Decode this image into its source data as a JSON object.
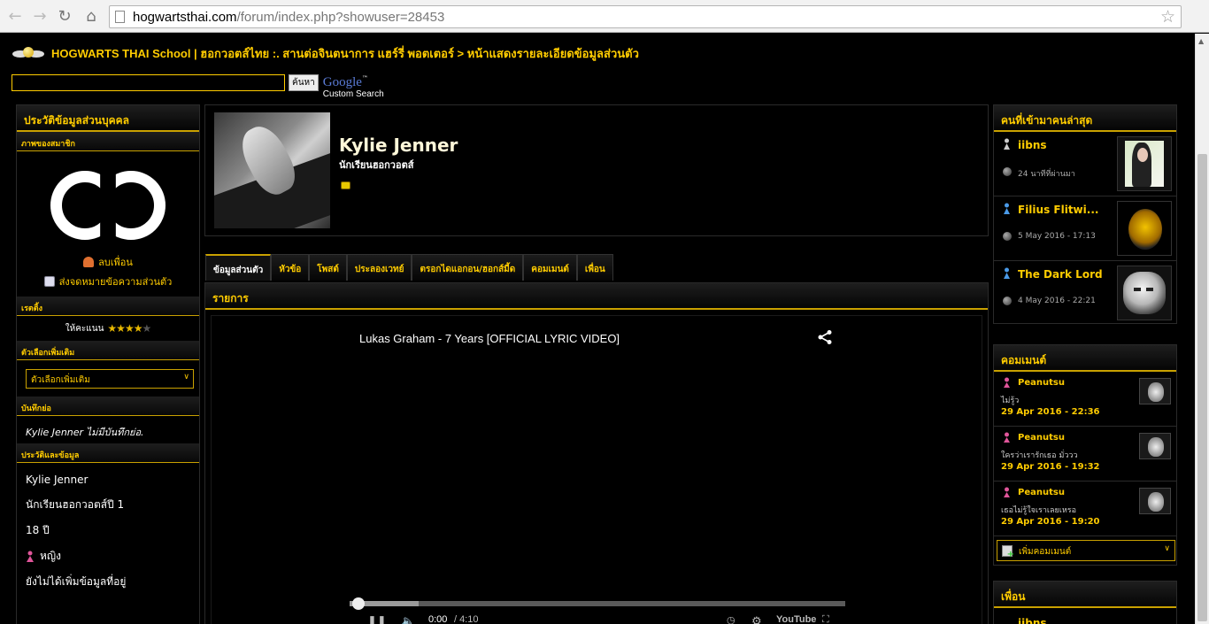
{
  "browser": {
    "url_host": "hogwartsthai.com",
    "url_path": "/forum/index.php?showuser=28453"
  },
  "header": {
    "breadcrumb": "HOGWARTS THAI School | ฮอกวอตส์ไทย :. สานต่อจินตนาการ แฮร์รี่ พอตเตอร์ > หน้าแสดงรายละเอียดข้อมูลส่วนตัว",
    "search_button": "ค้นหา",
    "google_word": "Google",
    "google_tm": "™",
    "google_custom": "Custom Search"
  },
  "left": {
    "title": "ประวัติข้อมูลส่วนบุคคล",
    "photo_head": "ภาพของสมาชิก",
    "remove_friend": "ลบเพื่อน",
    "send_pm": "ส่งจดหมายข้อความส่วนตัว",
    "rating_head": "เรตติ้ง",
    "rating_label": "ให้คะแนน",
    "rating_value": 4,
    "rating_max": 5,
    "options_head": "ตัวเลือกเพิ่มเติม",
    "options_select": "ตัวเลือกเพิ่มเติม",
    "notes_head": "บันทึกย่อ",
    "notes_text": "Kylie Jenner ไม่มีบันทึกย่อ.",
    "history_head": "ประวัติและข้อมูล",
    "history": [
      "Kylie Jenner",
      "นักเรียนฮอกวอตส์ปี 1",
      "18 ปี",
      "หญิง",
      "ยังไม่ได้เพิ่มข้อมูลที่อยู่"
    ]
  },
  "profile": {
    "name": "Kylie Jenner",
    "rank": "นักเรียนฮอกวอตส์"
  },
  "tabs": [
    {
      "label": "ข้อมูลส่วนตัว",
      "active": true
    },
    {
      "label": "หัวข้อ",
      "active": false
    },
    {
      "label": "โพสต์",
      "active": false
    },
    {
      "label": "ประลองเวทย์",
      "active": false
    },
    {
      "label": "ตรอกไดแอกอน/ฮอกส์มี้ด",
      "active": false
    },
    {
      "label": "คอมเมนต์",
      "active": false
    },
    {
      "label": "เพื่อน",
      "active": false
    }
  ],
  "content": {
    "title": "รายการ",
    "video_title": "Lukas Graham - 7 Years [OFFICIAL LYRIC VIDEO]",
    "video_time": "0:00",
    "video_duration": "/ 4:10",
    "video_logo": "YouTube",
    "progress_fraction": 0.0
  },
  "recent": {
    "title": "คนที่เข้ามาคนล่าสุด",
    "items": [
      {
        "name": "iibns",
        "time": "24 นาทีที่ผ่านมา",
        "pin_color": "#cccccc"
      },
      {
        "name": "Filius Flitwi...",
        "time": "5 May 2016 - 17:13",
        "pin_color": "#4a9ae8"
      },
      {
        "name": "The Dark Lord",
        "time": "4 May 2016 - 22:21",
        "pin_color": "#4a9ae8"
      }
    ]
  },
  "comments": {
    "title": "คอมเมนต์",
    "items": [
      {
        "name": "Peanutsu",
        "msg": "ไม่รู้ว",
        "date": "29 Apr 2016 - 22:36"
      },
      {
        "name": "Peanutsu",
        "msg": "ใครว่าเรารักเธอ มั่ววว",
        "date": "29 Apr 2016 - 19:32"
      },
      {
        "name": "Peanutsu",
        "msg": "เธอไม่รู้ใจเราเลยเหรอ",
        "date": "29 Apr 2016 - 19:20"
      }
    ],
    "add_label": "เพิ่มคอมเมนต์"
  },
  "friends": {
    "title": "เพื่อน",
    "peek": "iibns"
  },
  "colors": {
    "accent": "#ffcc00",
    "female_pin": "#e0559a",
    "male_pin": "#4a9ae8"
  }
}
